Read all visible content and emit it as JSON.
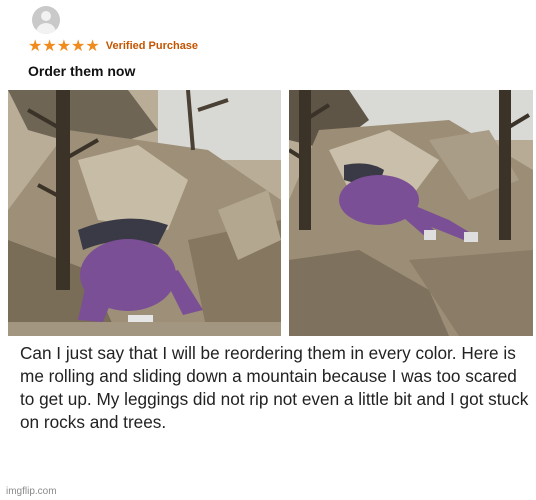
{
  "review": {
    "stars": [
      "★",
      "★",
      "★",
      "★",
      "★"
    ],
    "star_color": "#f08c1e",
    "verified_label": "Verified Purchase",
    "title": "Order them now",
    "body": "Can I just say that I will be reordering them in every color. Here is me rolling and sliding down a mountain because I was too scared to get up. My leggings did not rip not even a little bit and I got stuck on rocks and trees."
  },
  "colors": {
    "verified": "#c45500",
    "leggings": "#7b4f95",
    "rock": "#8a7c6a"
  },
  "watermark": "imgflip.com"
}
